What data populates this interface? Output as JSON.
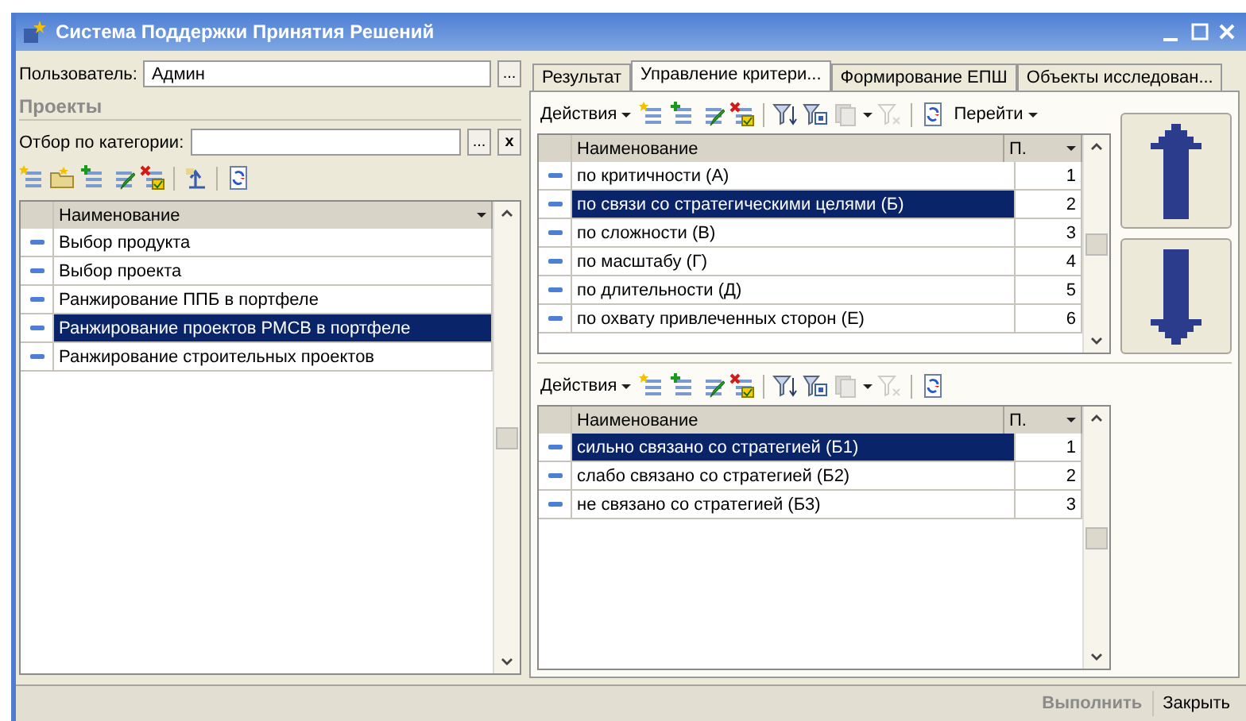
{
  "window": {
    "title": "Система Поддержки Принятия Решений"
  },
  "user": {
    "label": "Пользователь:",
    "value": "Админ",
    "select_button": "..."
  },
  "projects": {
    "title": "Проекты",
    "filter": {
      "label": "Отбор по категории:",
      "select_button": "...",
      "clear_button": "x"
    },
    "toolbar": [
      {
        "kind": "new",
        "disabled": false
      },
      {
        "kind": "folder",
        "disabled": false
      },
      {
        "kind": "add",
        "disabled": false
      },
      {
        "kind": "edit",
        "disabled": false
      },
      {
        "kind": "delete",
        "disabled": false
      },
      {
        "kind": "separator"
      },
      {
        "kind": "up",
        "disabled": false
      },
      {
        "kind": "separator"
      },
      {
        "kind": "refresh",
        "disabled": false
      }
    ],
    "table": {
      "columns": [
        "Наименование"
      ],
      "rows": [
        {
          "name": "Выбор продукта",
          "selected": false
        },
        {
          "name": "Выбор проекта",
          "selected": false
        },
        {
          "name": "Ранжирование ППБ в портфеле",
          "selected": false
        },
        {
          "name": "Ранжирование проектов РМСВ в портфеле",
          "selected": true
        },
        {
          "name": "Ранжирование строительных проектов",
          "selected": false
        }
      ]
    }
  },
  "tabs": [
    {
      "label": "Результат",
      "selected": false
    },
    {
      "label": "Управление критери...",
      "selected": true
    },
    {
      "label": "Формирование ЕПШ",
      "selected": false
    },
    {
      "label": "Объекты исследован...",
      "selected": false
    }
  ],
  "criteria": {
    "actions": "Действия",
    "goto": "Перейти",
    "toolbar": [
      {
        "kind": "new",
        "disabled": false
      },
      {
        "kind": "add",
        "disabled": false
      },
      {
        "kind": "edit",
        "disabled": false
      },
      {
        "kind": "delete",
        "disabled": false
      },
      {
        "kind": "separator"
      },
      {
        "kind": "filter",
        "disabled": false
      },
      {
        "kind": "filterform",
        "disabled": false
      },
      {
        "kind": "copy",
        "disabled": true
      },
      {
        "kind": "clearfilter",
        "disabled": true
      },
      {
        "kind": "separator"
      },
      {
        "kind": "refresh",
        "disabled": false
      }
    ],
    "table": {
      "columns": [
        "Наименование",
        "П."
      ],
      "rows": [
        {
          "name": "по критичности (А)",
          "number": "1",
          "selected": false
        },
        {
          "name": "по связи со стратегическими целями (Б)",
          "number": "2",
          "selected": true
        },
        {
          "name": "по сложности (В)",
          "number": "3",
          "selected": false
        },
        {
          "name": "по масштабу (Г)",
          "number": "4",
          "selected": false
        },
        {
          "name": "по длительности (Д)",
          "number": "5",
          "selected": false
        },
        {
          "name": "по охвату привлеченных сторон (Е)",
          "number": "6",
          "selected": false
        }
      ]
    }
  },
  "values": {
    "actions": "Действия",
    "toolbar": [
      {
        "kind": "new",
        "disabled": false
      },
      {
        "kind": "add",
        "disabled": false
      },
      {
        "kind": "edit",
        "disabled": false
      },
      {
        "kind": "delete",
        "disabled": false
      },
      {
        "kind": "separator"
      },
      {
        "kind": "filter",
        "disabled": false
      },
      {
        "kind": "filterform",
        "disabled": false
      },
      {
        "kind": "copy",
        "disabled": true
      },
      {
        "kind": "clearfilter",
        "disabled": true
      },
      {
        "kind": "separator"
      },
      {
        "kind": "refresh",
        "disabled": false
      }
    ],
    "table": {
      "columns": [
        "Наименование",
        "П."
      ],
      "rows": [
        {
          "name": "сильно связано со стратегией (Б1)",
          "number": "1",
          "selected": true
        },
        {
          "name": "слабо связано со стратегией (Б2)",
          "number": "2",
          "selected": false
        },
        {
          "name": "не связано со стратегией (Б3)",
          "number": "3",
          "selected": false
        }
      ]
    }
  },
  "footer": {
    "buttons": [
      {
        "label": "Выполнить",
        "disabled": true
      },
      {
        "label": "Закрыть",
        "disabled": false
      }
    ]
  }
}
